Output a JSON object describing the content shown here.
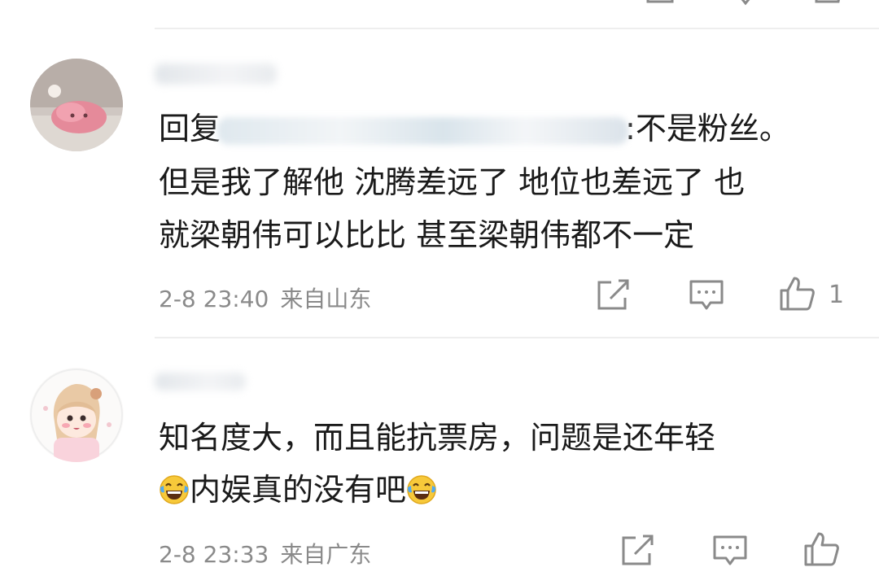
{
  "comments": [
    {
      "reply_prefix": "回复",
      "reply_suffix": ":不是粉丝。",
      "line2": "但是我了解他 沈腾差远了 地位也差远了 也",
      "line3": "就梁朝伟可以比比 甚至梁朝伟都不一定",
      "date": "2-8 23:40",
      "location": "来自山东",
      "like_count": "1"
    },
    {
      "line1": "知名度大，而且能抗票房，问题是还年轻",
      "line2_text": "内娱真的没有吧",
      "date": "2-8 23:33",
      "location": "来自广东"
    }
  ],
  "icons": {
    "share": "share-icon",
    "comment": "comment-icon",
    "like": "thumbs-up-icon",
    "emoji": "laughing-tears-emoji"
  },
  "colors": {
    "text": "#1a1a1a",
    "meta": "#8a8a8a",
    "divider": "#eeeeee"
  }
}
